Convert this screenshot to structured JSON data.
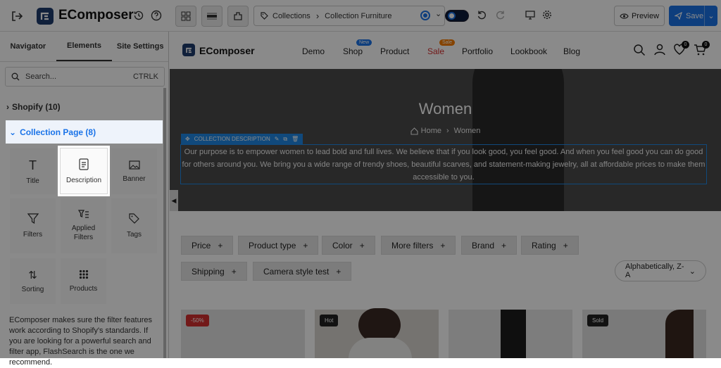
{
  "app": {
    "name": "EComposer"
  },
  "toolbar": {
    "breadcrumb_parent": "Collections",
    "breadcrumb_current": "Collection Furniture",
    "preview_label": "Preview",
    "save_label": "Save"
  },
  "sidebar": {
    "tabs": [
      "Navigator",
      "Elements",
      "Site Settings"
    ],
    "search_placeholder": "Search...",
    "search_shortcut": "CTRLK",
    "cat_shopify": "Shopify (10)",
    "cat_collection": "Collection Page (8)",
    "elements": [
      "Title",
      "Description",
      "Banner",
      "Filters",
      "Applied Filters",
      "Tags",
      "Sorting",
      "Products"
    ],
    "note": "EComposer makes sure the filter features work according to Shopify's standards. If you are looking for a powerful search and filter app, FlashSearch is the one we recommend."
  },
  "store": {
    "logo": "EComposer",
    "nav": [
      "Demo",
      "Shop",
      "Product",
      "Sale",
      "Portfolio",
      "Lookbook",
      "Blog"
    ],
    "nav_badges": {
      "shop": "New",
      "sale": "Sale"
    },
    "wishlist_count": "0",
    "cart_count": "0"
  },
  "hero": {
    "title": "Women",
    "crumb_home": "Home",
    "crumb_current": "Women",
    "selection_label": "COLLECTION DESCRIPTION",
    "description": "Our purpose is to empower women to lead bold and full lives. We believe that if you look good, you feel good. And when you feel good you can do good for others around you. We bring you a wide range of trendy shoes, beautiful scarves, and statement-making jewelry, all at affordable prices to make them accessible to you."
  },
  "filters": [
    "Price",
    "Product type",
    "Color",
    "More filters",
    "Brand",
    "Rating",
    "Shipping",
    "Camera style test"
  ],
  "sort_value": "Alphabetically, Z-A",
  "products": [
    {
      "tag": "-50%"
    },
    {
      "tag": "Hot"
    },
    {
      "tag": ""
    },
    {
      "tag": "Sold"
    }
  ],
  "colors": {
    "accent": "#1a73e8",
    "sale": "#d32f2f",
    "selection": "#1e88e5"
  }
}
